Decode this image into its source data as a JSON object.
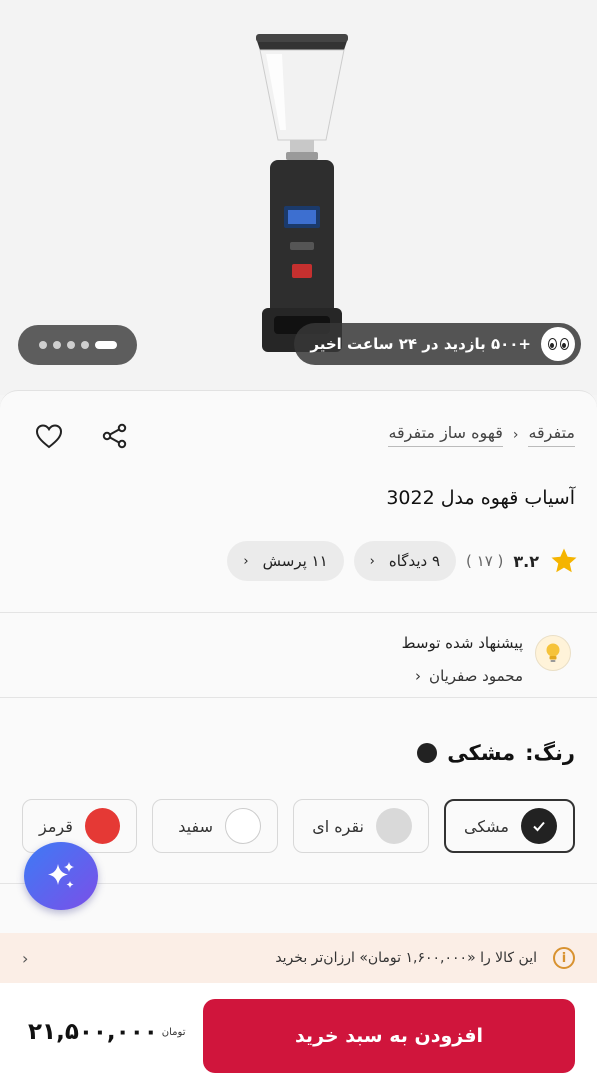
{
  "hero": {
    "views_text": "+۵۰۰ بازدید در ۲۴ ساعت اخیر",
    "slide_count": 5,
    "active_slide": 5
  },
  "product": {
    "breadcrumb": [
      "متفرقه",
      "قهوه ساز متفرقه"
    ],
    "title": "آسیاب قهوه مدل 3022",
    "rating": "۳.۲",
    "rating_count": "( ۱۷ )",
    "reviews_chip": "۹ دیدگاه",
    "questions_chip": "۱۱ پرسش"
  },
  "suggested": {
    "label": "پیشنهاد شده توسط",
    "name": "محمود صفریان"
  },
  "colors": {
    "heading_prefix": "رنگ:",
    "selected_name": "مشکی",
    "options": [
      {
        "name": "مشکی",
        "hex": "#222222",
        "selected": true
      },
      {
        "name": "نقره ای",
        "hex": "#d9d9d9",
        "selected": false
      },
      {
        "name": "سفید",
        "hex": "#ffffff",
        "selected": false
      },
      {
        "name": "قرمز",
        "hex": "#e53935",
        "selected": false
      }
    ]
  },
  "promo": {
    "text": "این کالا را «۱,۶۰۰,۰۰۰ تومان» ارزان‌تر بخرید"
  },
  "buy": {
    "add_to_cart": "افزودن به سبد خرید",
    "price": "۲۱,۵۰۰,۰۰۰",
    "currency": "تومان"
  },
  "theme": {
    "accent": "#d0153c",
    "star": "#f5b400",
    "info": "#d89230"
  }
}
